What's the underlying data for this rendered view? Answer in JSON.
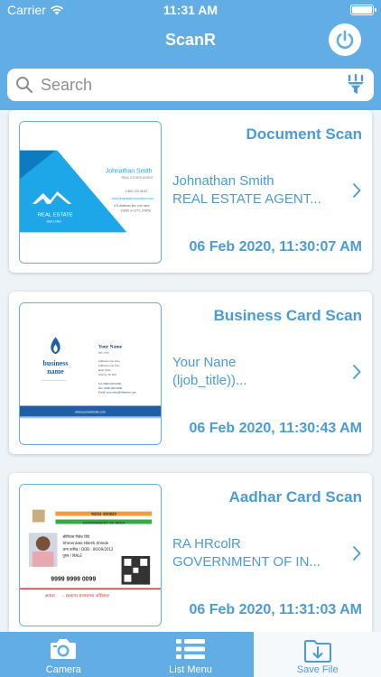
{
  "status": {
    "carrier": "Carrier",
    "time": "11:31 AM"
  },
  "nav": {
    "title": "ScanR"
  },
  "search": {
    "placeholder": "Search",
    "value": ""
  },
  "cards": [
    {
      "type": "Document Scan",
      "line1": "Johnathan Smith",
      "line2": "REAL ESTATE AGENT...",
      "date": "06 Feb 2020, 11:30:07 AM",
      "thumb": {
        "name": "Johnathan Smith",
        "title": "REAL ESTATE AGENT",
        "logo_text": "REAL ESTATE",
        "logo_sub": "BUILDING",
        "phone": "1 800 123 45 67",
        "web": "www.realestateinnovation.com",
        "addr1": "123 Address line one here",
        "addr2": "10000 w CITY, STATE"
      }
    },
    {
      "type": "Business Card Scan",
      "line1": "Your Nane",
      "line2": "(ljob_title))...",
      "date": "06 Feb 2020, 11:30:43 AM",
      "thumb": {
        "logo_line1": "business",
        "logo_line2": "name",
        "name": "Your Name",
        "title": "(job_title)",
        "addr1": "Address Line One,",
        "addr2": "Address Line Two,",
        "addr3": "Real Town,",
        "addr4": "County, 00 100",
        "tel": "Tel: 0900 000 0000",
        "fax": "Fax: 0900 000 0000",
        "email": "Email: you.name@thisisme.com",
        "web": "www.yourwebsite.com"
      }
    },
    {
      "type": "Aadhar Card Scan",
      "line1": "RA HRcolR",
      "line2": "GOVERNMENT OF IN...",
      "date": "06 Feb 2020, 11:31:03 AM",
      "thumb": {
        "header_hi": "भारत सरकार",
        "header_en": "GOVERNMENT OF INDIA",
        "name_hi": "श्रीनिवास निलेश शिंदे",
        "name_en": "Shreenivas Nilesh Shinde",
        "dob": "जन्म तारीख / DOB : 06/09/2012",
        "gender": "पुरुष / MALE",
        "number": "9999 9999 0099",
        "footer_brand": "आधार",
        "footer_text": "- सामान्य माणसाचा अधिकार"
      }
    }
  ],
  "tabs": [
    {
      "label": "Camera",
      "icon": "camera-icon"
    },
    {
      "label": "List Menu",
      "icon": "list-icon"
    },
    {
      "label": "Save File",
      "icon": "save-file-icon",
      "selected": true
    }
  ],
  "colors": {
    "accent": "#62ade3",
    "text_blue": "#4a9bd8"
  }
}
